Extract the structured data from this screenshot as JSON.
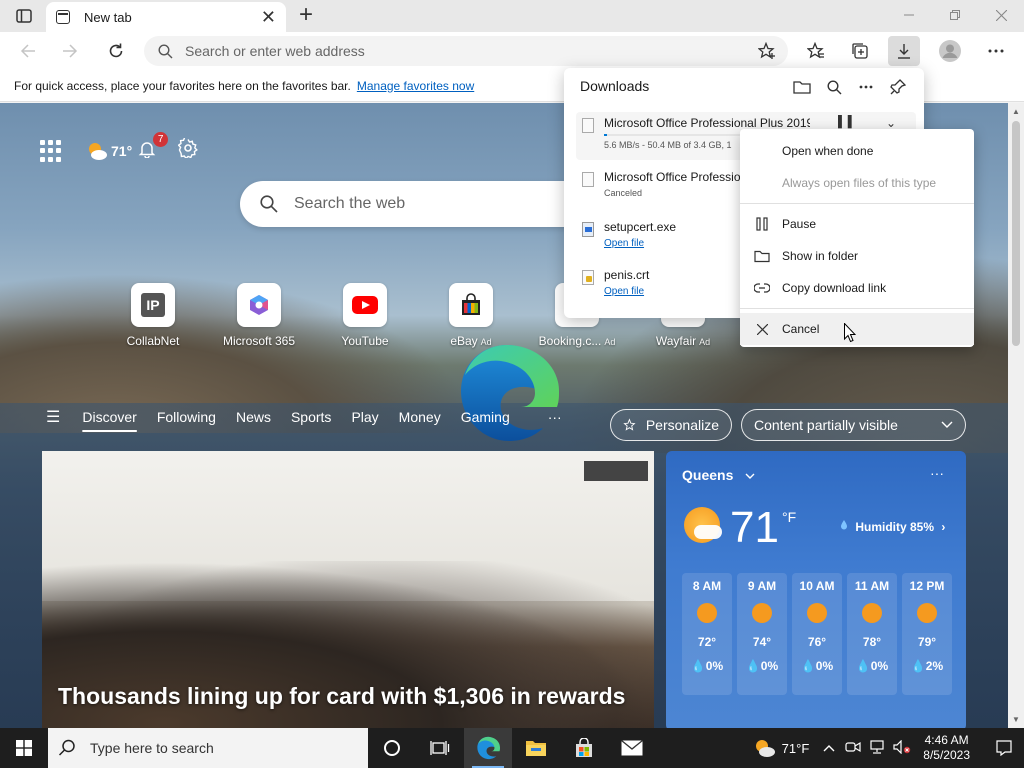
{
  "browser": {
    "tab_title": "New tab",
    "new_tab_symbol": "+",
    "tab_close_symbol": "✕",
    "address_placeholder": "Search or enter web address"
  },
  "favorites_bar": {
    "text": "For quick access, place your favorites here on the favorites bar.",
    "link": "Manage favorites now"
  },
  "newtab": {
    "weather_temp": "71°",
    "notification_count": "7",
    "search_placeholder": "Search the web",
    "quick_links": [
      {
        "label": "CollabNet",
        "tile_text": "IP",
        "ad": ""
      },
      {
        "label": "Microsoft 365",
        "tile_text": "",
        "ad": ""
      },
      {
        "label": "YouTube",
        "tile_text": "",
        "ad": ""
      },
      {
        "label": "eBay",
        "tile_text": "",
        "ad": "Ad"
      },
      {
        "label": "Booking.c...",
        "tile_text": "B.",
        "ad": "Ad"
      },
      {
        "label": "Wayfair",
        "tile_text": "",
        "ad": "Ad"
      }
    ],
    "nav": [
      "Discover",
      "Following",
      "News",
      "Sports",
      "Play",
      "Money",
      "Gaming"
    ],
    "nav_more": "···",
    "personalize": "Personalize",
    "content_visibility": "Content partially visible",
    "headline": "Thousands lining up for card with $1,306 in rewards"
  },
  "weather_card": {
    "location": "Queens",
    "temp": "71",
    "unit": "°F",
    "humidity": "Humidity 85%",
    "more": "···",
    "hours": [
      {
        "time": "8 AM",
        "temp": "72°",
        "precip": "0%"
      },
      {
        "time": "9 AM",
        "temp": "74°",
        "precip": "0%"
      },
      {
        "time": "10 AM",
        "temp": "76°",
        "precip": "0%"
      },
      {
        "time": "11 AM",
        "temp": "78°",
        "precip": "0%"
      },
      {
        "time": "12 PM",
        "temp": "79°",
        "precip": "2%"
      }
    ]
  },
  "downloads": {
    "title": "Downloads",
    "items": [
      {
        "name": "Microsoft Office Professional Plus 2019",
        "status": "5.6 MB/s - 50.4 MB of 3.4 GB, 1",
        "progress": 0.015,
        "link": ""
      },
      {
        "name": "Microsoft Office Professional Plus 2019",
        "status": "Canceled",
        "link": ""
      },
      {
        "name": "setupcert.exe",
        "status": "",
        "link": "Open file"
      },
      {
        "name": "penis.crt",
        "status": "",
        "link": "Open file"
      }
    ]
  },
  "context_menu": {
    "items": [
      {
        "label": "Open when done",
        "enabled": true
      },
      {
        "label": "Always open files of this type",
        "enabled": false
      },
      {
        "label": "Pause",
        "enabled": true
      },
      {
        "label": "Show in folder",
        "enabled": true
      },
      {
        "label": "Copy download link",
        "enabled": true
      },
      {
        "label": "Cancel",
        "enabled": true
      }
    ]
  },
  "taskbar": {
    "search_placeholder": "Type here to search",
    "weather": "71°F",
    "time": "4:46 AM",
    "date": "8/5/2023"
  }
}
